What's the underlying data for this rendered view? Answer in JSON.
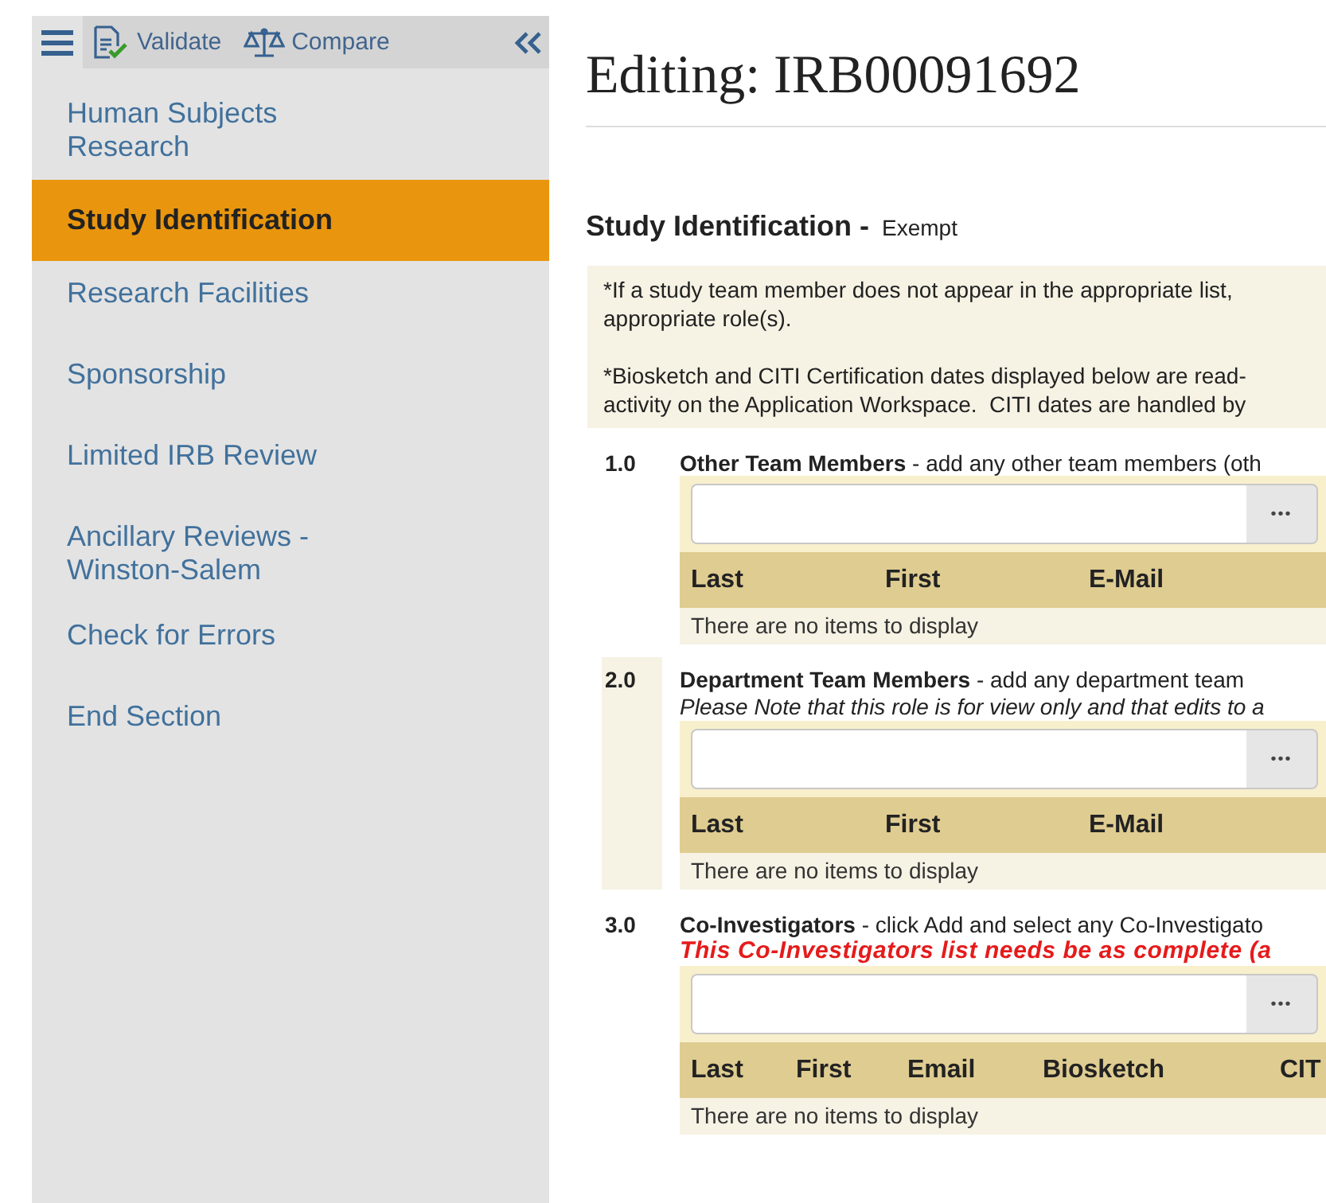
{
  "toolbar": {
    "buttons": [
      {
        "kind": "validate",
        "label": "Validate"
      },
      {
        "kind": "compare",
        "label": "Compare"
      }
    ]
  },
  "sidebar": {
    "items": [
      {
        "label": "Human Subjects Research",
        "selected": false
      },
      {
        "label": "Study Identification",
        "selected": true
      },
      {
        "label": "Research Facilities",
        "selected": false
      },
      {
        "label": "Sponsorship",
        "selected": false
      },
      {
        "label": "Limited IRB Review",
        "selected": false
      },
      {
        "label": "Ancillary Reviews - Winston-Salem",
        "selected": false
      },
      {
        "label": "Check for Errors",
        "selected": false
      },
      {
        "label": "End Section",
        "selected": false
      }
    ]
  },
  "page": {
    "title": "Editing: IRB00091692",
    "heading": "Study Identification -",
    "subheading": "Exempt",
    "notice": [
      [
        "*If a study team member does not appear in the appropriate list,",
        "appropriate role(s)."
      ],
      [
        "*Biosketch and CITI Certification dates displayed below are read-",
        "activity on the Application Workspace.  CITI dates are handled by"
      ]
    ],
    "sections": [
      {
        "number": "1.0",
        "highlighted": false,
        "title": "Other Team Members",
        "description": " - add any other team members (oth",
        "button": "•••",
        "columns": [
          "Last",
          "First",
          "E-Mail"
        ],
        "empty": "There are no items to display"
      },
      {
        "number": "2.0",
        "highlighted": true,
        "title": "Department Team Members",
        "description": " - add any department team",
        "note": {
          "kind": "info",
          "text": "Please Note that this role is for view only and that edits to a"
        },
        "button": "•••",
        "columns": [
          "Last",
          "First",
          "E-Mail"
        ],
        "empty": "There are no items to display"
      },
      {
        "number": "3.0",
        "highlighted": false,
        "title": "Co-Investigators",
        "description": " - click Add and select any Co-Investigato",
        "note": {
          "kind": "warning",
          "text": "This Co-Investigators list needs be as complete (a"
        },
        "button": "•••",
        "columns": [
          "Last",
          "First",
          "Email",
          "Biosketch",
          "CIT"
        ],
        "empty": "There are no items to display"
      }
    ]
  }
}
